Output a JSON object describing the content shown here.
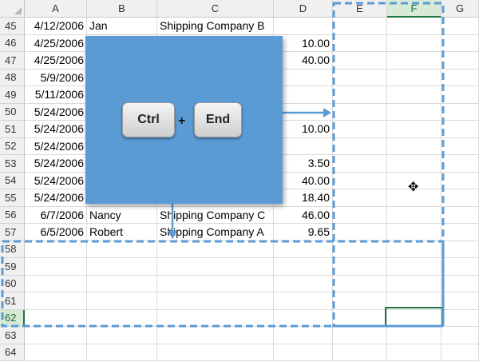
{
  "columns": [
    "A",
    "B",
    "C",
    "D",
    "E",
    "F",
    "G"
  ],
  "selected_column": "F",
  "rows": [
    {
      "num": "45",
      "a": "4/12/2006",
      "b": "Jan",
      "c": "Shipping Company B",
      "d": ""
    },
    {
      "num": "46",
      "a": "4/25/2006",
      "b": "",
      "c": "",
      "d": "10.00"
    },
    {
      "num": "47",
      "a": "4/25/2006",
      "b": "",
      "c": "",
      "d": "40.00"
    },
    {
      "num": "48",
      "a": "5/9/2006",
      "b": "",
      "c": "",
      "d": ""
    },
    {
      "num": "49",
      "a": "5/11/2006",
      "b": "",
      "c": "",
      "d": ""
    },
    {
      "num": "50",
      "a": "5/24/2006",
      "b": "",
      "c": "",
      "d": ""
    },
    {
      "num": "51",
      "a": "5/24/2006",
      "b": "",
      "c": "",
      "d": "10.00"
    },
    {
      "num": "52",
      "a": "5/24/2006",
      "b": "",
      "c": "",
      "d": ""
    },
    {
      "num": "53",
      "a": "5/24/2006",
      "b": "",
      "c": "",
      "d": "3.50"
    },
    {
      "num": "54",
      "a": "5/24/2006",
      "b": "",
      "c": "",
      "d": "40.00"
    },
    {
      "num": "55",
      "a": "5/24/2006",
      "b": "",
      "c": "",
      "d": "18.40"
    },
    {
      "num": "56",
      "a": "6/7/2006",
      "b": "Nancy",
      "c": "Shipping Company C",
      "d": "46.00"
    },
    {
      "num": "57",
      "a": "6/5/2006",
      "b": "Robert",
      "c": "Shipping Company A",
      "d": "9.65"
    },
    {
      "num": "58",
      "a": "",
      "b": "",
      "c": "",
      "d": ""
    },
    {
      "num": "59",
      "a": "",
      "b": "",
      "c": "",
      "d": ""
    },
    {
      "num": "60",
      "a": "",
      "b": "",
      "c": "",
      "d": ""
    },
    {
      "num": "61",
      "a": "",
      "b": "",
      "c": "",
      "d": ""
    },
    {
      "num": "62",
      "a": "",
      "b": "",
      "c": "",
      "d": ""
    },
    {
      "num": "63",
      "a": "",
      "b": "",
      "c": "",
      "d": ""
    },
    {
      "num": "64",
      "a": "",
      "b": "",
      "c": "",
      "d": ""
    }
  ],
  "selected_row": "62",
  "shortcut": {
    "key1": "Ctrl",
    "plus": "+",
    "key2": "End"
  },
  "cursor_glyph": "✥",
  "colors": {
    "overlay": "#5b9bd5",
    "dash": "#5b9bd5",
    "selection": "#217346"
  }
}
